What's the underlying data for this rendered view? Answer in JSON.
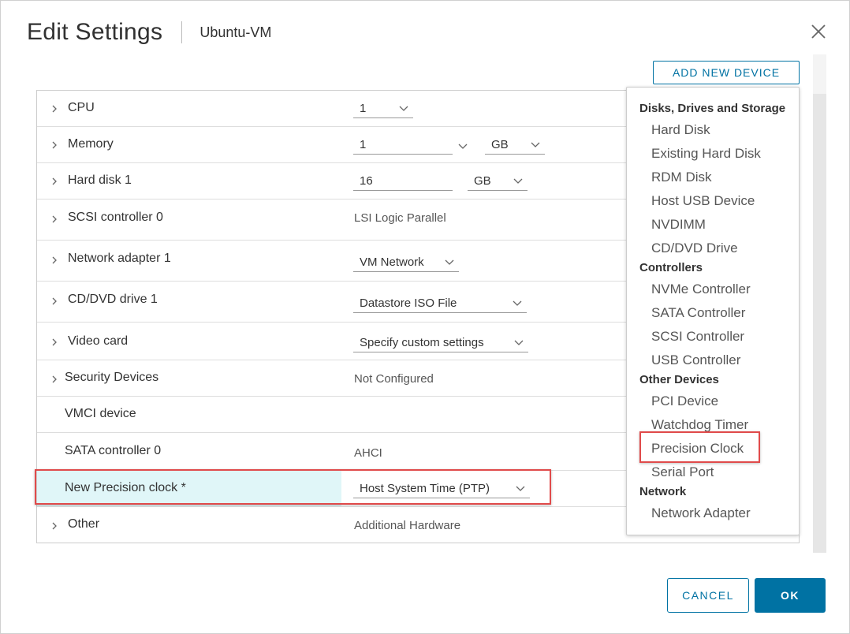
{
  "dialog": {
    "title": "Edit Settings",
    "vm_name": "Ubuntu-VM",
    "add_device_label": "ADD NEW DEVICE",
    "cancel_label": "CANCEL",
    "ok_label": "OK"
  },
  "rows": {
    "cpu": {
      "label": "CPU",
      "value": "1"
    },
    "memory": {
      "label": "Memory",
      "value": "1",
      "unit": "GB"
    },
    "hard_disk": {
      "label": "Hard disk 1",
      "value": "16",
      "unit": "GB"
    },
    "scsi": {
      "label": "SCSI controller 0",
      "value": "LSI Logic Parallel"
    },
    "network": {
      "label": "Network adapter 1",
      "value": "VM Network"
    },
    "cddvd": {
      "label": "CD/DVD drive 1",
      "value": "Datastore ISO File"
    },
    "video": {
      "label": "Video card",
      "value": "Specify custom settings"
    },
    "security": {
      "label": "Security Devices",
      "value": "Not Configured"
    },
    "vmci": {
      "label": "VMCI device"
    },
    "sata": {
      "label": "SATA controller 0",
      "value": "AHCI"
    },
    "precision": {
      "label": "New Precision clock *",
      "value": "Host System Time (PTP)"
    },
    "other": {
      "label": "Other",
      "value": "Additional Hardware"
    }
  },
  "menu": {
    "group_storage": "Disks, Drives and Storage",
    "storage_items": [
      "Hard Disk",
      "Existing Hard Disk",
      "RDM Disk",
      "Host USB Device",
      "NVDIMM",
      "CD/DVD Drive"
    ],
    "group_controllers": "Controllers",
    "controller_items": [
      "NVMe Controller",
      "SATA Controller",
      "SCSI Controller",
      "USB Controller"
    ],
    "group_other": "Other Devices",
    "other_items": [
      "PCI Device",
      "Watchdog Timer",
      "Precision Clock",
      "Serial Port"
    ],
    "group_network": "Network",
    "network_items": [
      "Network Adapter"
    ]
  },
  "colors": {
    "accent": "#0072a3",
    "highlight_bg": "#e0f6f8",
    "callout_red": "#e04b4b"
  }
}
